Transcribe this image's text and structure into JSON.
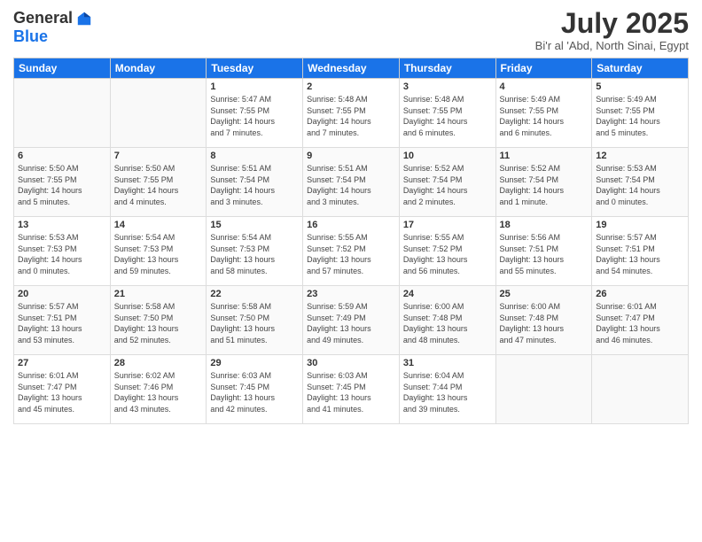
{
  "header": {
    "logo_general": "General",
    "logo_blue": "Blue",
    "title": "July 2025",
    "subtitle": "Bi'r al 'Abd, North Sinai, Egypt"
  },
  "weekdays": [
    "Sunday",
    "Monday",
    "Tuesday",
    "Wednesday",
    "Thursday",
    "Friday",
    "Saturday"
  ],
  "weeks": [
    [
      {
        "day": "",
        "info": ""
      },
      {
        "day": "",
        "info": ""
      },
      {
        "day": "1",
        "info": "Sunrise: 5:47 AM\nSunset: 7:55 PM\nDaylight: 14 hours\nand 7 minutes."
      },
      {
        "day": "2",
        "info": "Sunrise: 5:48 AM\nSunset: 7:55 PM\nDaylight: 14 hours\nand 7 minutes."
      },
      {
        "day": "3",
        "info": "Sunrise: 5:48 AM\nSunset: 7:55 PM\nDaylight: 14 hours\nand 6 minutes."
      },
      {
        "day": "4",
        "info": "Sunrise: 5:49 AM\nSunset: 7:55 PM\nDaylight: 14 hours\nand 6 minutes."
      },
      {
        "day": "5",
        "info": "Sunrise: 5:49 AM\nSunset: 7:55 PM\nDaylight: 14 hours\nand 5 minutes."
      }
    ],
    [
      {
        "day": "6",
        "info": "Sunrise: 5:50 AM\nSunset: 7:55 PM\nDaylight: 14 hours\nand 5 minutes."
      },
      {
        "day": "7",
        "info": "Sunrise: 5:50 AM\nSunset: 7:55 PM\nDaylight: 14 hours\nand 4 minutes."
      },
      {
        "day": "8",
        "info": "Sunrise: 5:51 AM\nSunset: 7:54 PM\nDaylight: 14 hours\nand 3 minutes."
      },
      {
        "day": "9",
        "info": "Sunrise: 5:51 AM\nSunset: 7:54 PM\nDaylight: 14 hours\nand 3 minutes."
      },
      {
        "day": "10",
        "info": "Sunrise: 5:52 AM\nSunset: 7:54 PM\nDaylight: 14 hours\nand 2 minutes."
      },
      {
        "day": "11",
        "info": "Sunrise: 5:52 AM\nSunset: 7:54 PM\nDaylight: 14 hours\nand 1 minute."
      },
      {
        "day": "12",
        "info": "Sunrise: 5:53 AM\nSunset: 7:54 PM\nDaylight: 14 hours\nand 0 minutes."
      }
    ],
    [
      {
        "day": "13",
        "info": "Sunrise: 5:53 AM\nSunset: 7:53 PM\nDaylight: 14 hours\nand 0 minutes."
      },
      {
        "day": "14",
        "info": "Sunrise: 5:54 AM\nSunset: 7:53 PM\nDaylight: 13 hours\nand 59 minutes."
      },
      {
        "day": "15",
        "info": "Sunrise: 5:54 AM\nSunset: 7:53 PM\nDaylight: 13 hours\nand 58 minutes."
      },
      {
        "day": "16",
        "info": "Sunrise: 5:55 AM\nSunset: 7:52 PM\nDaylight: 13 hours\nand 57 minutes."
      },
      {
        "day": "17",
        "info": "Sunrise: 5:55 AM\nSunset: 7:52 PM\nDaylight: 13 hours\nand 56 minutes."
      },
      {
        "day": "18",
        "info": "Sunrise: 5:56 AM\nSunset: 7:51 PM\nDaylight: 13 hours\nand 55 minutes."
      },
      {
        "day": "19",
        "info": "Sunrise: 5:57 AM\nSunset: 7:51 PM\nDaylight: 13 hours\nand 54 minutes."
      }
    ],
    [
      {
        "day": "20",
        "info": "Sunrise: 5:57 AM\nSunset: 7:51 PM\nDaylight: 13 hours\nand 53 minutes."
      },
      {
        "day": "21",
        "info": "Sunrise: 5:58 AM\nSunset: 7:50 PM\nDaylight: 13 hours\nand 52 minutes."
      },
      {
        "day": "22",
        "info": "Sunrise: 5:58 AM\nSunset: 7:50 PM\nDaylight: 13 hours\nand 51 minutes."
      },
      {
        "day": "23",
        "info": "Sunrise: 5:59 AM\nSunset: 7:49 PM\nDaylight: 13 hours\nand 49 minutes."
      },
      {
        "day": "24",
        "info": "Sunrise: 6:00 AM\nSunset: 7:48 PM\nDaylight: 13 hours\nand 48 minutes."
      },
      {
        "day": "25",
        "info": "Sunrise: 6:00 AM\nSunset: 7:48 PM\nDaylight: 13 hours\nand 47 minutes."
      },
      {
        "day": "26",
        "info": "Sunrise: 6:01 AM\nSunset: 7:47 PM\nDaylight: 13 hours\nand 46 minutes."
      }
    ],
    [
      {
        "day": "27",
        "info": "Sunrise: 6:01 AM\nSunset: 7:47 PM\nDaylight: 13 hours\nand 45 minutes."
      },
      {
        "day": "28",
        "info": "Sunrise: 6:02 AM\nSunset: 7:46 PM\nDaylight: 13 hours\nand 43 minutes."
      },
      {
        "day": "29",
        "info": "Sunrise: 6:03 AM\nSunset: 7:45 PM\nDaylight: 13 hours\nand 42 minutes."
      },
      {
        "day": "30",
        "info": "Sunrise: 6:03 AM\nSunset: 7:45 PM\nDaylight: 13 hours\nand 41 minutes."
      },
      {
        "day": "31",
        "info": "Sunrise: 6:04 AM\nSunset: 7:44 PM\nDaylight: 13 hours\nand 39 minutes."
      },
      {
        "day": "",
        "info": ""
      },
      {
        "day": "",
        "info": ""
      }
    ]
  ]
}
